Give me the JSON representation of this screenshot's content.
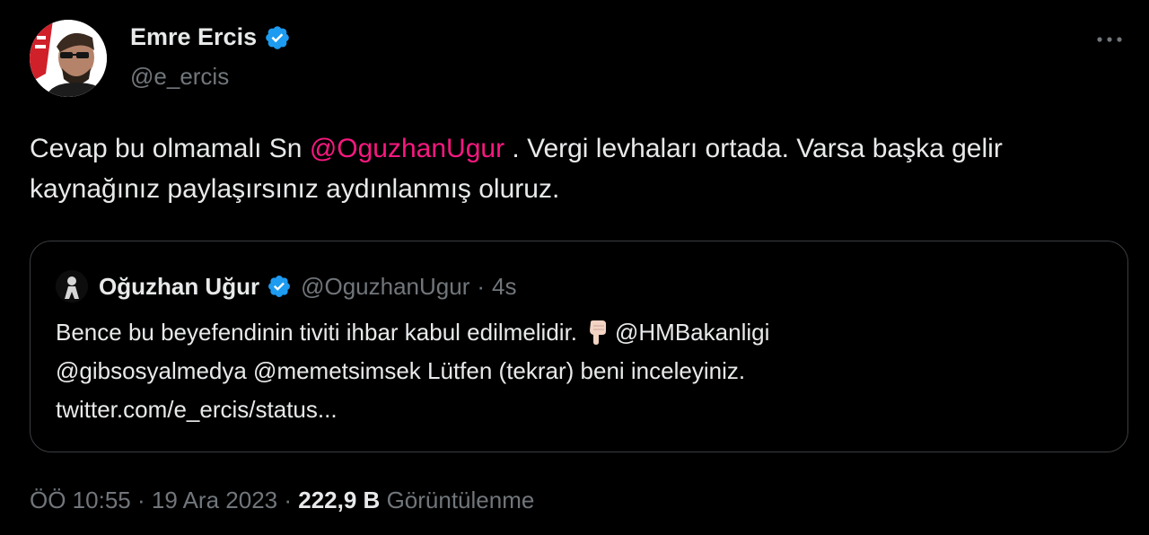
{
  "tweet": {
    "author": {
      "name": "Emre Ercis",
      "handle": "@e_ercis",
      "verified": true
    },
    "text_parts": {
      "part1": "Cevap bu olmamalı Sn ",
      "mention": "@OguzhanUgur",
      "part2": " . Vergi levhaları ortada. Varsa başka gelir kaynağınız paylaşırsınız aydınlanmış oluruz."
    },
    "quoted": {
      "name": "Oğuzhan Uğur",
      "handle": "@OguzhanUgur",
      "separator": "·",
      "time": "4s",
      "line1_text": "Bence bu beyefendinin tiviti ihbar kabul edilmelidir.",
      "line1_mention": "@HMBakanligi",
      "line2": "@gibsosyalmedya @memetsimsek Lütfen (tekrar) beni inceleyiniz.",
      "line3": "twitter.com/e_ercis/status..."
    },
    "meta": {
      "time": "ÖÖ 10:55",
      "sep1": "·",
      "date": "19 Ara 2023",
      "sep2": "·",
      "views": "222,9 B",
      "views_label": "Görüntülenme"
    }
  },
  "icons": {
    "verified": "verified-badge-icon",
    "more": "more-horizontal-icon",
    "pointing": "pointing-down-emoji"
  },
  "colors": {
    "background": "#000000",
    "text": "#e7e9ea",
    "secondary": "#71767b",
    "mention": "#f91880",
    "verified": "#1d9bf0",
    "border": "#3a3d41"
  }
}
